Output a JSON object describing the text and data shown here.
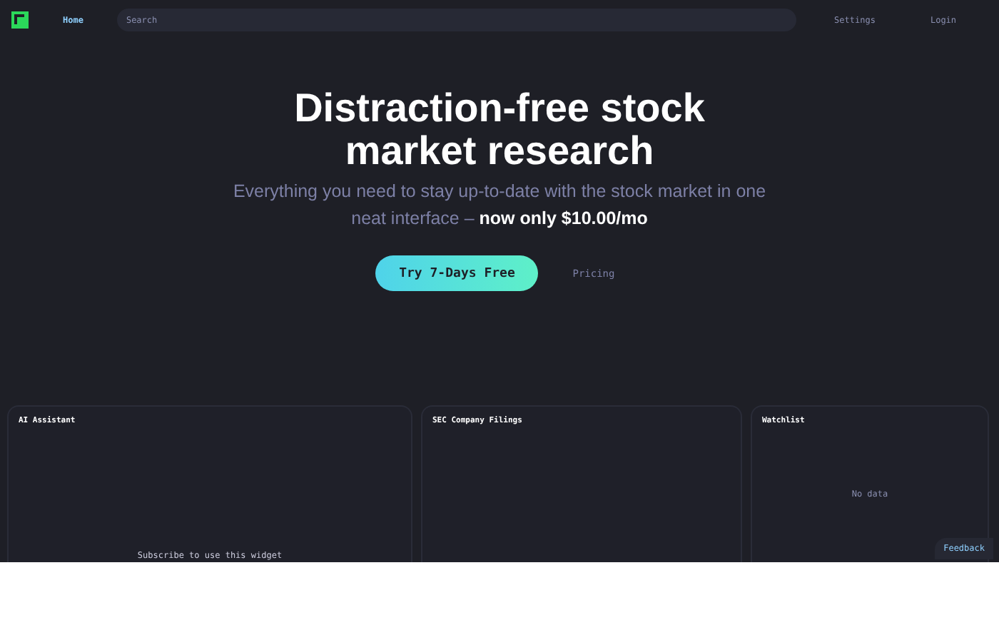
{
  "nav": {
    "home": "Home",
    "search_placeholder": "Search",
    "links": [
      "Settings",
      "Login"
    ]
  },
  "hero": {
    "title": "Distraction-free stock market research",
    "subtitle": "Everything you need to stay up-to-date with the stock market in one neat interface – **now only $10.00/mo**",
    "cta": "Try 7-Days Free",
    "secondary": "Pricing"
  },
  "widgets": [
    {
      "title": "AI Assistant",
      "kind": "locked",
      "message": "Subscribe to use this widget"
    },
    {
      "title": "SEC Company Filings",
      "kind": "empty"
    },
    {
      "title": "Watchlist",
      "kind": "nodata",
      "message": "No data"
    }
  ],
  "feedback": "Feedback"
}
